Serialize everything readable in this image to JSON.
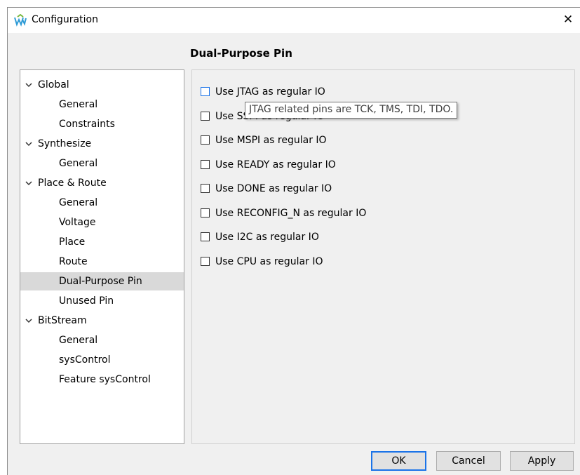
{
  "window": {
    "title": "Configuration",
    "close_symbol": "✕",
    "icon": "gowin-logo-icon"
  },
  "page_title": "Dual-Purpose Pin",
  "tree": [
    {
      "label": "Global",
      "level": 0,
      "expanded": true
    },
    {
      "label": "General",
      "level": 1
    },
    {
      "label": "Constraints",
      "level": 1
    },
    {
      "label": "Synthesize",
      "level": 0,
      "expanded": true
    },
    {
      "label": "General",
      "level": 1
    },
    {
      "label": "Place & Route",
      "level": 0,
      "expanded": true
    },
    {
      "label": "General",
      "level": 1
    },
    {
      "label": "Voltage",
      "level": 1
    },
    {
      "label": "Place",
      "level": 1
    },
    {
      "label": "Route",
      "level": 1
    },
    {
      "label": "Dual-Purpose Pin",
      "level": 1,
      "selected": true
    },
    {
      "label": "Unused Pin",
      "level": 1
    },
    {
      "label": "BitStream",
      "level": 0,
      "expanded": true
    },
    {
      "label": "General",
      "level": 1
    },
    {
      "label": "sysControl",
      "level": 1
    },
    {
      "label": "Feature sysControl",
      "level": 1
    }
  ],
  "options": [
    {
      "label": "Use JTAG as regular IO",
      "checked": false
    },
    {
      "label": "Use SSPI as regular IO",
      "checked": false
    },
    {
      "label": "Use MSPI as regular IO",
      "checked": false
    },
    {
      "label": "Use READY as regular IO",
      "checked": false
    },
    {
      "label": "Use DONE as regular IO",
      "checked": false
    },
    {
      "label": "Use RECONFIG_N as regular IO",
      "checked": false
    },
    {
      "label": "Use I2C as regular IO",
      "checked": false
    },
    {
      "label": "Use CPU  as regular IO",
      "checked": false
    }
  ],
  "tooltip": "JTAG related pins are TCK, TMS, TDI, TDO.",
  "buttons": {
    "ok": "OK",
    "cancel": "Cancel",
    "apply": "Apply"
  },
  "colors": {
    "accent": "#1a73e8",
    "selected_row": "#d9d9d9"
  }
}
